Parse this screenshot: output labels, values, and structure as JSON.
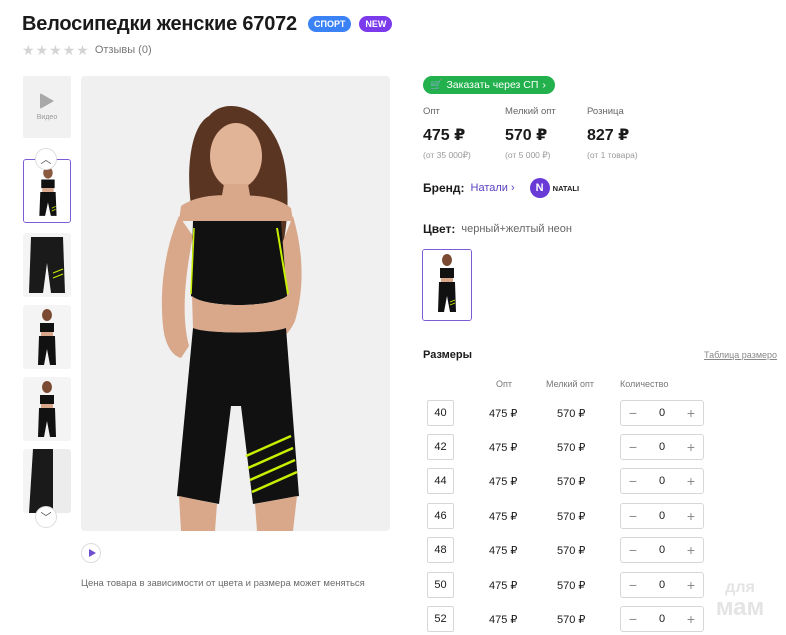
{
  "product": {
    "title": "Велосипедки женские 67072",
    "badges": [
      "СПОРТ",
      "NEW"
    ],
    "rating_stars": 0,
    "reviews_label": "Отзывы (0)"
  },
  "gallery": {
    "video_label": "Видео",
    "thumbnail_count": 5,
    "active_index": 0
  },
  "order_sp": {
    "label": "Заказать через СП"
  },
  "prices": [
    {
      "label": "Опт",
      "value": "475 ₽",
      "note": "(от 35 000₽)"
    },
    {
      "label": "Мелкий опт",
      "value": "570 ₽",
      "note": "(от 5 000 ₽)"
    },
    {
      "label": "Розница",
      "value": "827 ₽",
      "note": "(от 1 товара)"
    }
  ],
  "brand": {
    "label": "Бренд:",
    "name": "Натали",
    "logo_text": "NATALI"
  },
  "color": {
    "label": "Цвет:",
    "value": "черный+желтый неон"
  },
  "sizes": {
    "title": "Размеры",
    "table_link": "Таблица размеро",
    "col_opt": "Опт",
    "col_small_opt": "Мелкий опт",
    "col_qty": "Количество",
    "rows": [
      {
        "size": "40",
        "opt": "475 ₽",
        "small_opt": "570 ₽",
        "qty": "0"
      },
      {
        "size": "42",
        "opt": "475 ₽",
        "small_opt": "570 ₽",
        "qty": "0"
      },
      {
        "size": "44",
        "opt": "475 ₽",
        "small_opt": "570 ₽",
        "qty": "0"
      },
      {
        "size": "46",
        "opt": "475 ₽",
        "small_opt": "570 ₽",
        "qty": "0"
      },
      {
        "size": "48",
        "opt": "475 ₽",
        "small_opt": "570 ₽",
        "qty": "0"
      },
      {
        "size": "50",
        "opt": "475 ₽",
        "small_opt": "570 ₽",
        "qty": "0"
      },
      {
        "size": "52",
        "opt": "475 ₽",
        "small_opt": "570 ₽",
        "qty": "0"
      }
    ]
  },
  "price_note": "Цена товара в зависимости от цвета и размера может меняться",
  "watermark": {
    "line1": "для",
    "line2": "мам"
  },
  "colors": {
    "accent": "#7c5cd6",
    "sport_badge": "#3b82f6",
    "new_badge": "#7c3aed",
    "sp_button": "#22b14c",
    "neon": "#c6f000"
  },
  "icons": {
    "stepper_minus": "minus-icon",
    "stepper_plus": "plus-icon"
  }
}
